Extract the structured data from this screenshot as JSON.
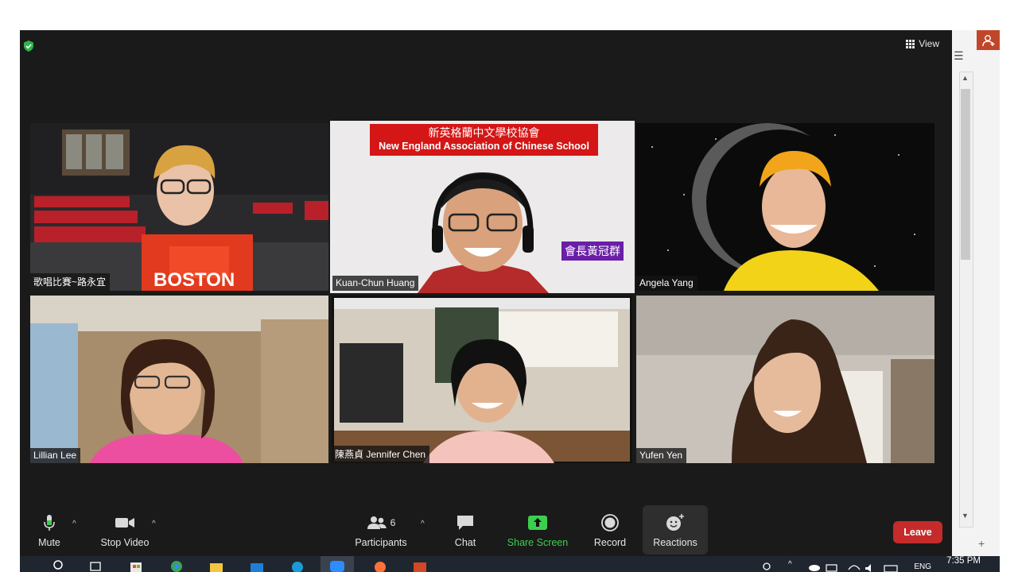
{
  "view_button": {
    "label": "View"
  },
  "participants": [
    {
      "name": "歌唱比賽~路永宜"
    },
    {
      "name": "Kuan-Chun Huang",
      "banner_line1": "新英格蘭中文學校協會",
      "banner_line2": "New England Association of Chinese School",
      "title_badge": "會長黃冠群"
    },
    {
      "name": "Angela Yang"
    },
    {
      "name": "Lillian Lee"
    },
    {
      "name": "陳燕貞 Jennifer Chen"
    },
    {
      "name": "Yufen Yen"
    }
  ],
  "toolbar": {
    "mute": "Mute",
    "stop_video": "Stop Video",
    "participants_label": "Participants",
    "participants_count": "6",
    "chat": "Chat",
    "share_screen": "Share Screen",
    "record": "Record",
    "reactions": "Reactions",
    "leave": "Leave"
  },
  "taskbar": {
    "language": "ENG",
    "time": "7:35 PM"
  },
  "colors": {
    "share_green": "#3ccf4e",
    "leave_red": "#c52b2b",
    "active_border": "#d6e84a"
  }
}
